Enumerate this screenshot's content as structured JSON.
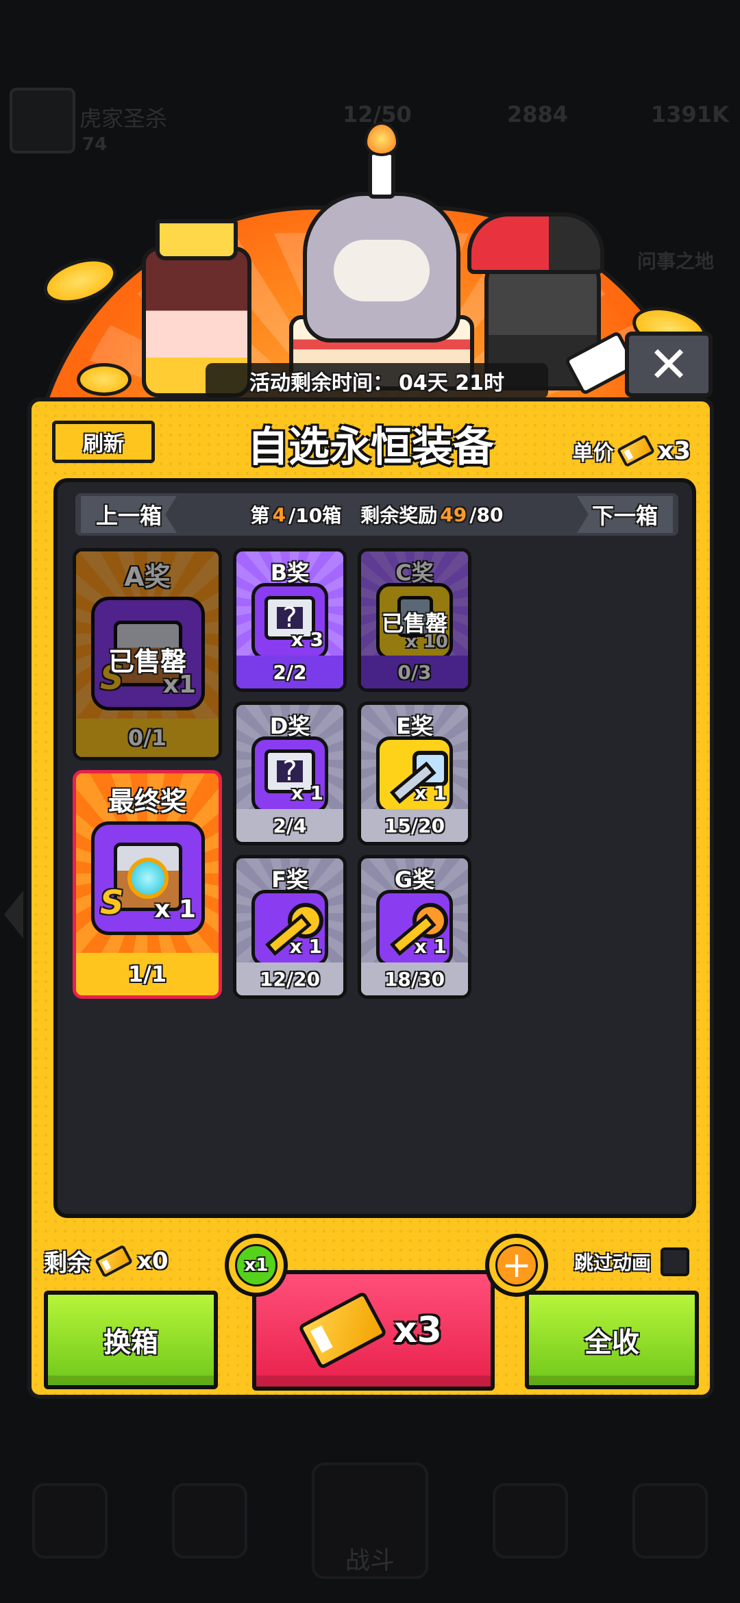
{
  "background_hud": {
    "player_name": "虎家圣杀",
    "level": "74",
    "energy": "12/50",
    "gold": "2884",
    "gems": "1391K",
    "side_label": "问事之地",
    "bottom_center_label": "战斗"
  },
  "banner": {
    "timer_label": "活动剩余时间：",
    "timer_value": "04天 21时"
  },
  "panel": {
    "refresh_label": "刷新",
    "title": "自选永恒装备",
    "unit_price_label": "单价",
    "unit_price_mult": "x3",
    "nav": {
      "prev_label": "上一箱",
      "next_label": "下一箱",
      "box_prefix": "第",
      "box_current": "4",
      "box_suffix": "/10箱",
      "reward_label": "剩余奖励",
      "reward_current": "49",
      "reward_total": "/80"
    },
    "prizes": [
      {
        "name": "A奖",
        "qty": "x1",
        "progress": "0/1",
        "sold_out": true,
        "sold_label": "已售罄",
        "badge": "S"
      },
      {
        "name": "B奖",
        "qty": "x 3",
        "progress": "2/2",
        "sold_out": false
      },
      {
        "name": "C奖",
        "qty": "x 10",
        "progress": "0/3",
        "sold_out": true,
        "sold_label": "已售罄"
      },
      {
        "name": "D奖",
        "qty": "x 1",
        "progress": "2/4",
        "sold_out": false
      },
      {
        "name": "E奖",
        "qty": "x 1",
        "progress": "15/20",
        "sold_out": false
      },
      {
        "name": "F奖",
        "qty": "x 1",
        "progress": "12/20",
        "sold_out": false
      },
      {
        "name": "G奖",
        "qty": "x 1",
        "progress": "18/30",
        "sold_out": false
      },
      {
        "name": "最终奖",
        "qty": "x 1",
        "progress": "1/1",
        "sold_out": false,
        "badge": "S"
      }
    ],
    "remaining_label": "剩余",
    "remaining_value": "x0",
    "skip_label": "跳过动画",
    "multiplier_badge": "x1",
    "plus_symbol": "+",
    "swap_label": "换箱",
    "draw_mult": "x3",
    "collect_all_label": "全收"
  },
  "colors": {
    "panel": "#ffc51f",
    "purple": "#8a3cf0",
    "grey": "#8e8ca8",
    "orange_final": "#ff7a12",
    "green_btn": "#8fe020",
    "red_btn": "#f0335d"
  }
}
